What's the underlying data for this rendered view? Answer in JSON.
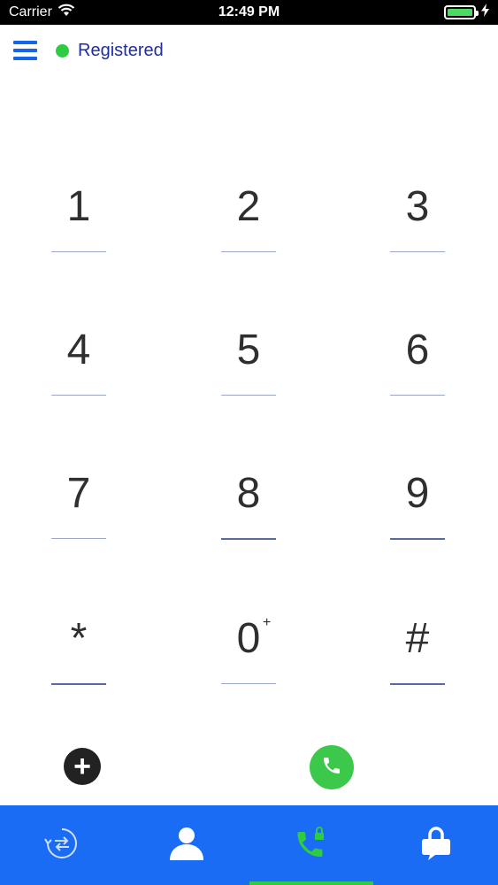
{
  "status_bar": {
    "carrier": "Carrier",
    "time": "12:49 PM"
  },
  "header": {
    "registration_status": "Registered",
    "status_color": "#2ecc40"
  },
  "keypad": {
    "keys": [
      {
        "digit": "1"
      },
      {
        "digit": "2"
      },
      {
        "digit": "3"
      },
      {
        "digit": "4"
      },
      {
        "digit": "5"
      },
      {
        "digit": "6"
      },
      {
        "digit": "7"
      },
      {
        "digit": "8"
      },
      {
        "digit": "9"
      },
      {
        "digit": "*"
      },
      {
        "digit": "0",
        "sup": "+"
      },
      {
        "digit": "#"
      }
    ]
  },
  "actions": {
    "add_symbol": "+",
    "call_icon": "phone-icon",
    "call_color": "#3cc84a"
  },
  "tabbar": {
    "background": "#1a6cf5",
    "tabs": [
      {
        "icon": "call-history-icon",
        "active": false
      },
      {
        "icon": "contact-icon",
        "active": false
      },
      {
        "icon": "secure-call-icon",
        "active": true
      },
      {
        "icon": "secure-message-icon",
        "active": false
      }
    ],
    "active_indicator_color": "#2ecc40"
  }
}
